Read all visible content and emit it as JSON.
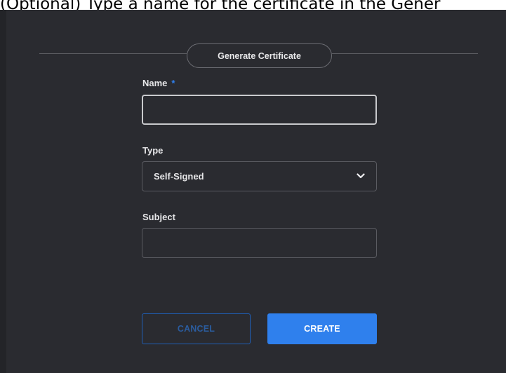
{
  "caption": "(Optional) Type a name for the certificate in the Gener",
  "dialog": {
    "title": "Generate Certificate",
    "fields": {
      "name": {
        "label": "Name",
        "required_marker": "*",
        "value": ""
      },
      "type": {
        "label": "Type",
        "selected": "Self-Signed",
        "icon": "chevron-down-icon"
      },
      "subject": {
        "label": "Subject",
        "value": ""
      }
    },
    "buttons": {
      "cancel": "CANCEL",
      "create": "CREATE"
    }
  },
  "colors": {
    "background": "#2a2b30",
    "accent": "#2f80ed",
    "text": "#e6e6e8"
  }
}
